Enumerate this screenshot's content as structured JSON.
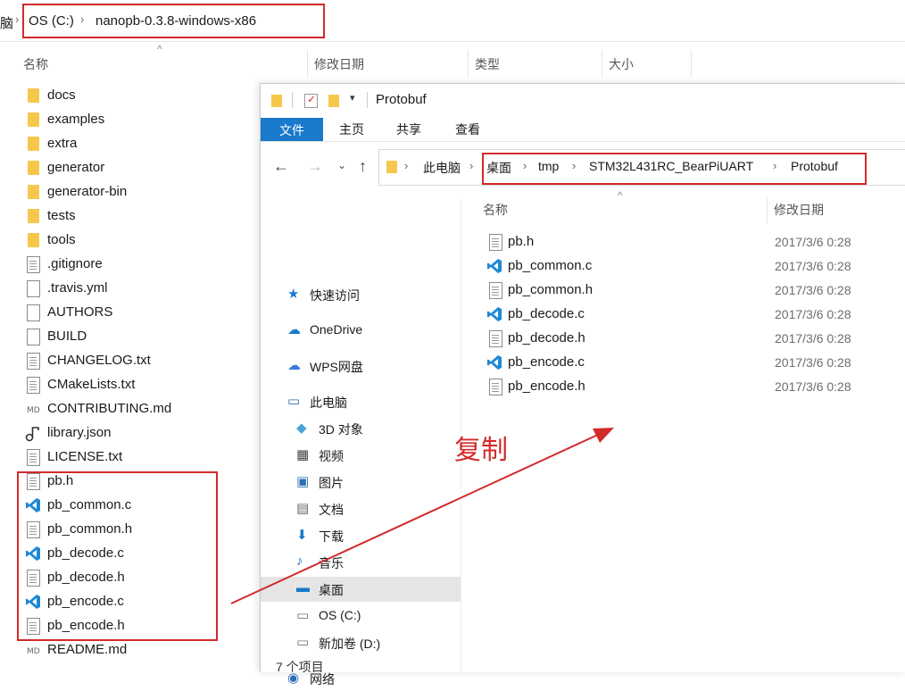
{
  "back_window": {
    "breadcrumb": {
      "prefix": "脑",
      "drive": "OS (C:)",
      "folder": "nanopb-0.3.8-windows-x86"
    },
    "columns": {
      "name": "名称",
      "modified": "修改日期",
      "type": "类型",
      "size": "大小"
    },
    "items": [
      {
        "name": "docs",
        "icon": "folder-icon"
      },
      {
        "name": "examples",
        "icon": "folder-icon"
      },
      {
        "name": "extra",
        "icon": "folder-icon"
      },
      {
        "name": "generator",
        "icon": "folder-icon"
      },
      {
        "name": "generator-bin",
        "icon": "folder-icon"
      },
      {
        "name": "tests",
        "icon": "folder-icon"
      },
      {
        "name": "tools",
        "icon": "folder-icon"
      },
      {
        "name": ".gitignore",
        "icon": "text-file-icon"
      },
      {
        "name": ".travis.yml",
        "icon": "blank-file-icon"
      },
      {
        "name": "AUTHORS",
        "icon": "blank-file-icon"
      },
      {
        "name": "BUILD",
        "icon": "blank-file-icon"
      },
      {
        "name": "CHANGELOG.txt",
        "icon": "text-file-icon"
      },
      {
        "name": "CMakeLists.txt",
        "icon": "text-file-icon"
      },
      {
        "name": "CONTRIBUTING.md",
        "icon": "markdown-file-icon"
      },
      {
        "name": "library.json",
        "icon": "json-file-icon"
      },
      {
        "name": "LICENSE.txt",
        "icon": "text-file-icon"
      },
      {
        "name": "pb.h",
        "icon": "text-file-icon"
      },
      {
        "name": "pb_common.c",
        "icon": "vscode-icon"
      },
      {
        "name": "pb_common.h",
        "icon": "text-file-icon"
      },
      {
        "name": "pb_decode.c",
        "icon": "vscode-icon"
      },
      {
        "name": "pb_decode.h",
        "icon": "text-file-icon"
      },
      {
        "name": "pb_encode.c",
        "icon": "vscode-icon"
      },
      {
        "name": "pb_encode.h",
        "icon": "text-file-icon"
      },
      {
        "name": "README.md",
        "icon": "markdown-file-icon"
      }
    ]
  },
  "front_window": {
    "title": "Protobuf",
    "ribbon_tabs": [
      "文件",
      "主页",
      "共享",
      "查看"
    ],
    "address": [
      "此电脑",
      "桌面",
      "tmp",
      "STM32L431RC_BearPiUART",
      "Protobuf"
    ],
    "nav": [
      {
        "label": "快速访问",
        "icon": "star-icon"
      },
      {
        "label": "OneDrive",
        "icon": "cloud-icon"
      },
      {
        "label": "WPS网盘",
        "icon": "wps-cloud-icon"
      },
      {
        "label": "此电脑",
        "icon": "computer-icon"
      },
      {
        "label": "3D 对象",
        "icon": "cube-icon"
      },
      {
        "label": "视频",
        "icon": "video-icon"
      },
      {
        "label": "图片",
        "icon": "picture-icon"
      },
      {
        "label": "文档",
        "icon": "document-icon"
      },
      {
        "label": "下载",
        "icon": "download-icon"
      },
      {
        "label": "音乐",
        "icon": "music-icon"
      },
      {
        "label": "桌面",
        "icon": "desktop-icon"
      },
      {
        "label": "OS (C:)",
        "icon": "drive-icon"
      },
      {
        "label": "新加卷 (D:)",
        "icon": "drive-icon"
      },
      {
        "label": "网络",
        "icon": "network-icon"
      }
    ],
    "columns": {
      "name": "名称",
      "modified": "修改日期"
    },
    "files": [
      {
        "name": "pb.h",
        "date": "2017/3/6 0:28",
        "icon": "text-file-icon"
      },
      {
        "name": "pb_common.c",
        "date": "2017/3/6 0:28",
        "icon": "vscode-icon"
      },
      {
        "name": "pb_common.h",
        "date": "2017/3/6 0:28",
        "icon": "text-file-icon"
      },
      {
        "name": "pb_decode.c",
        "date": "2017/3/6 0:28",
        "icon": "vscode-icon"
      },
      {
        "name": "pb_decode.h",
        "date": "2017/3/6 0:28",
        "icon": "text-file-icon"
      },
      {
        "name": "pb_encode.c",
        "date": "2017/3/6 0:28",
        "icon": "vscode-icon"
      },
      {
        "name": "pb_encode.h",
        "date": "2017/3/6 0:28",
        "icon": "text-file-icon"
      }
    ],
    "status": "7 个项目"
  },
  "annotation": {
    "copy_label": "复制"
  },
  "colors": {
    "annotation_red": "#d42a2a",
    "accent_blue": "#1979ca",
    "selected_bg": "#e5e5e5"
  }
}
